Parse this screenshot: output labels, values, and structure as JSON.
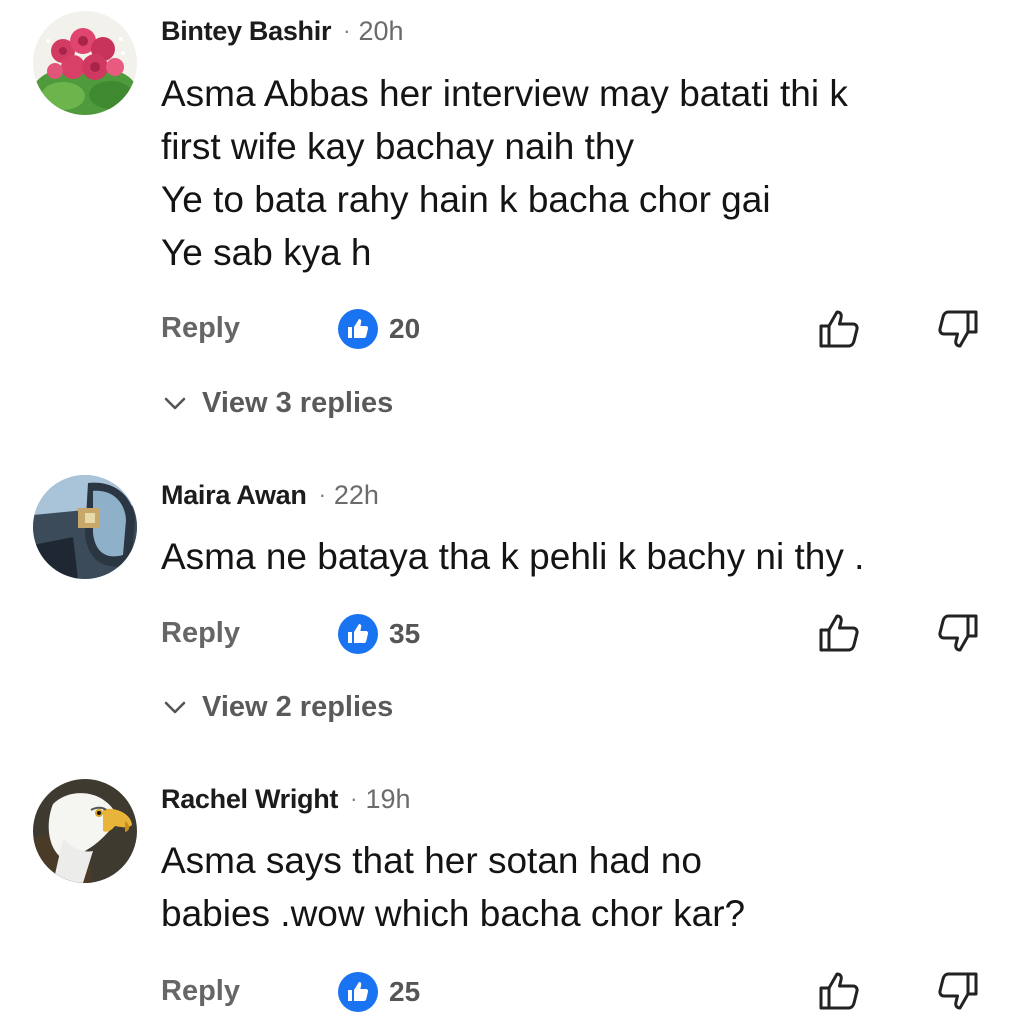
{
  "comments": [
    {
      "author": "Bintey Bashir",
      "separator": "·",
      "time": "20h",
      "avatar_icon": "rose-bouquet-avatar",
      "text": "Asma Abbas her interview may batati thi k\nfirst wife kay bachay naih thy\nYe to bata rahy hain k bacha chor gai\nYe sab kya h",
      "reply_label": "Reply",
      "like_count": "20",
      "view_replies": "View 3 replies"
    },
    {
      "author": "Maira Awan",
      "separator": "·",
      "time": "22h",
      "avatar_icon": "car-mirror-avatar",
      "text": "Asma ne bataya tha k pehli k bachy ni thy .",
      "reply_label": "Reply",
      "like_count": "35",
      "view_replies": "View 2 replies"
    },
    {
      "author": "Rachel Wright",
      "separator": "·",
      "time": "19h",
      "avatar_icon": "eagle-avatar",
      "text": "Asma says that her sotan had no\nbabies .wow which bacha chor kar?",
      "reply_label": "Reply",
      "like_count": "25"
    }
  ],
  "colors": {
    "like_badge": "#1a73f0",
    "secondary_text": "#666666"
  }
}
